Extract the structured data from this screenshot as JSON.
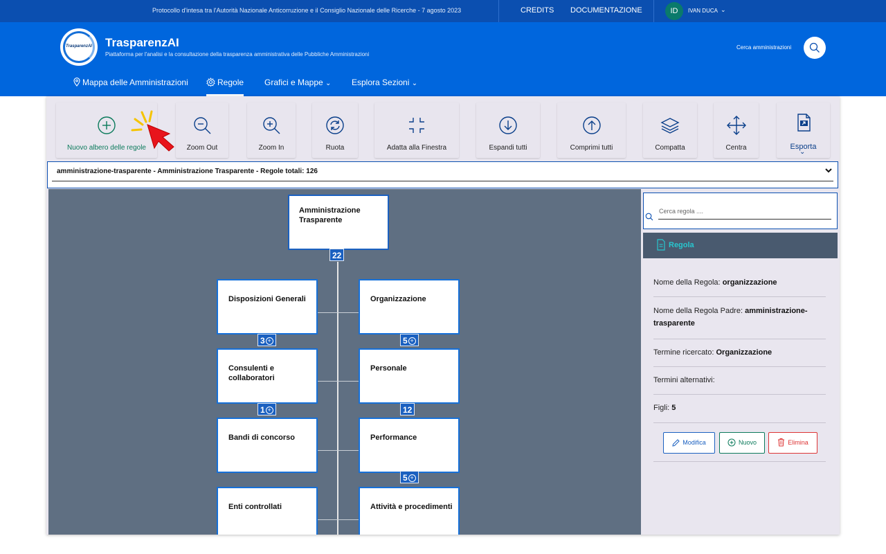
{
  "topbar": {
    "notice": "Protocollo d'intesa tra l'Autorità Nazionale Anticorruzione e il Consiglio Nazionale delle Ricerche - 7 agosto 2023",
    "credits": "CREDITS",
    "documentation": "DOCUMENTAZIONE",
    "user_initials": "ID",
    "user_name": "IVAN DUCA"
  },
  "header": {
    "logo_text": "TrasparenzAI",
    "title": "TrasparenzAI",
    "subtitle": "Piattaforma per l'analisi e la consultazione della trasparenza amministrativa delle Pubbliche Amministrazioni",
    "search_label": "Cerca amministrazioni"
  },
  "nav": {
    "items": [
      {
        "label": "Mappa delle Amministrazioni",
        "icon": "map-pin-icon"
      },
      {
        "label": "Regole",
        "icon": "gear-icon",
        "active": true
      },
      {
        "label": "Grafici e Mappe",
        "icon": "chevron-down-icon"
      },
      {
        "label": "Esplora Sezioni",
        "icon": "chevron-down-icon"
      }
    ]
  },
  "toolbar": {
    "new_tree": "Nuovo albero delle regole",
    "zoom_out": "Zoom Out",
    "zoom_in": "Zoom In",
    "rotate": "Ruota",
    "fit": "Adatta alla Finestra",
    "expand": "Espandi tutti",
    "collapse": "Comprimi tutti",
    "compact": "Compatta",
    "center": "Centra",
    "export": "Esporta"
  },
  "selector": {
    "value": "amministrazione-trasparente - Amministrazione Trasparente - Regole totali: 126"
  },
  "tree": {
    "root": {
      "label": "Amministrazione Trasparente",
      "count": "22"
    },
    "left": [
      {
        "label": "Disposizioni Generali",
        "count": "3"
      },
      {
        "label": "Consulenti e collaboratori",
        "count": "1"
      },
      {
        "label": "Bandi di concorso",
        "count": ""
      },
      {
        "label": "Enti controllati",
        "count": ""
      }
    ],
    "right": [
      {
        "label": "Organizzazione",
        "count": "5"
      },
      {
        "label": "Personale",
        "count": "12"
      },
      {
        "label": "Performance",
        "count": "5"
      },
      {
        "label": "Attività e procedimenti",
        "count": ""
      }
    ]
  },
  "panel": {
    "search_placeholder": "Cerca regola ....",
    "heading": "Regola",
    "rule_name_label": "Nome della Regola:",
    "rule_name": "organizzazione",
    "parent_label": "Nome della Regola Padre:",
    "parent": "amministrazione-trasparente",
    "term_label": "Termine ricercato:",
    "term": "Organizzazione",
    "alt_label": "Termini alternativi:",
    "children_label": "Figli:",
    "children": "5",
    "edit": "Modifica",
    "new": "Nuovo",
    "delete": "Elimina"
  },
  "colors": {
    "primary": "#0066dd",
    "topbar": "#0b4fb0",
    "canvas": "#5f6f82",
    "accent_teal": "#28c6cf",
    "success": "#0b7a5b",
    "danger": "#dd3333"
  }
}
